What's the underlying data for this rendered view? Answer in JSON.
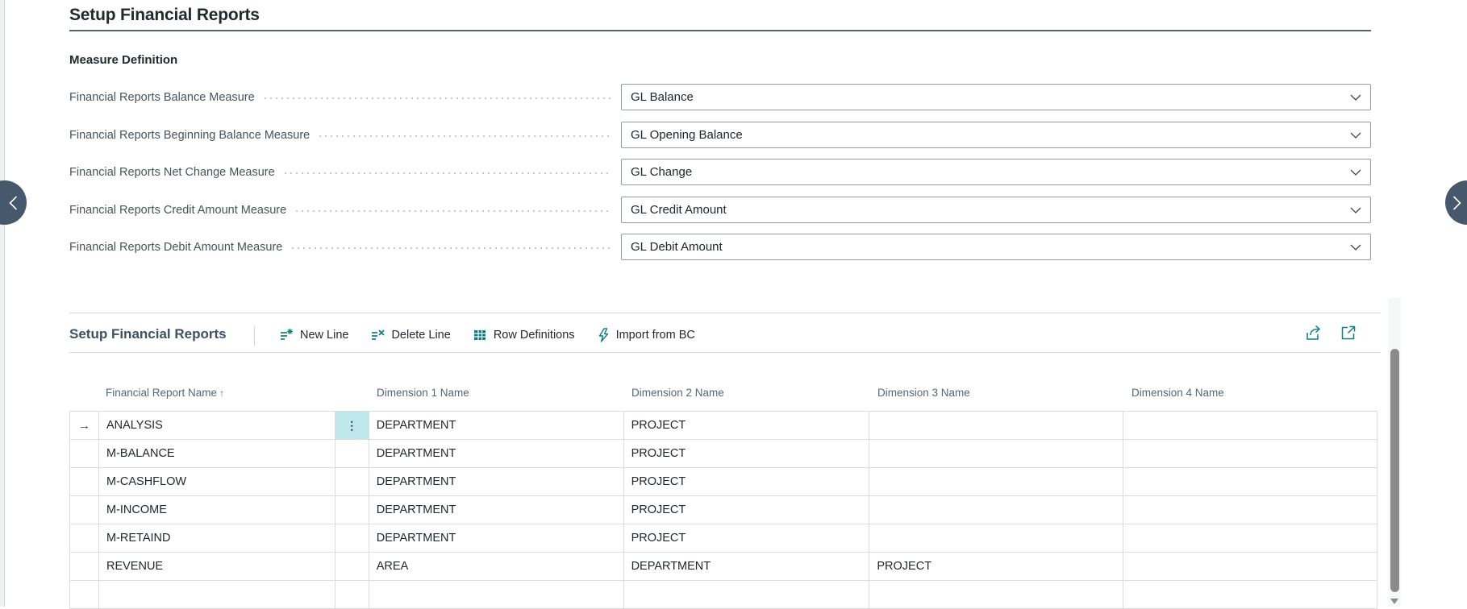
{
  "page": {
    "title": "Setup Financial Reports"
  },
  "measure_section": {
    "heading": "Measure Definition",
    "fields": [
      {
        "label": "Financial Reports Balance Measure",
        "value": "GL Balance"
      },
      {
        "label": "Financial Reports Beginning Balance Measure",
        "value": "GL Opening Balance"
      },
      {
        "label": "Financial Reports Net Change Measure",
        "value": "GL Change"
      },
      {
        "label": "Financial Reports Credit Amount Measure",
        "value": "GL Credit Amount"
      },
      {
        "label": "Financial Reports Debit Amount Measure",
        "value": "GL Debit Amount"
      }
    ]
  },
  "list_section": {
    "heading": "Setup Financial Reports",
    "toolbar": [
      {
        "label": "New Line",
        "icon": "new-line-icon"
      },
      {
        "label": "Delete Line",
        "icon": "delete-line-icon"
      },
      {
        "label": "Row Definitions",
        "icon": "row-definitions-icon"
      },
      {
        "label": "Import from BC",
        "icon": "import-from-bc-icon"
      }
    ],
    "actions": [
      {
        "icon": "share-icon"
      },
      {
        "icon": "expand-icon"
      }
    ],
    "table": {
      "columns": [
        "Financial Report Name",
        "Dimension 1 Name",
        "Dimension 2 Name",
        "Dimension 3 Name",
        "Dimension 4 Name"
      ],
      "sort_column": "Financial Report Name",
      "sort_indicator": "↑",
      "selected_row_marker": "→",
      "row_options_glyph": "⋮",
      "rows": [
        {
          "name": "ANALYSIS",
          "dim1": "DEPARTMENT",
          "dim2": "PROJECT",
          "dim3": "",
          "dim4": ""
        },
        {
          "name": "M-BALANCE",
          "dim1": "DEPARTMENT",
          "dim2": "PROJECT",
          "dim3": "",
          "dim4": ""
        },
        {
          "name": "M-CASHFLOW",
          "dim1": "DEPARTMENT",
          "dim2": "PROJECT",
          "dim3": "",
          "dim4": ""
        },
        {
          "name": "M-INCOME",
          "dim1": "DEPARTMENT",
          "dim2": "PROJECT",
          "dim3": "",
          "dim4": ""
        },
        {
          "name": "M-RETAIND",
          "dim1": "DEPARTMENT",
          "dim2": "PROJECT",
          "dim3": "",
          "dim4": ""
        },
        {
          "name": "REVENUE",
          "dim1": "AREA",
          "dim2": "DEPARTMENT",
          "dim3": "PROJECT",
          "dim4": ""
        },
        {
          "name": "",
          "dim1": "",
          "dim2": "",
          "dim3": "",
          "dim4": ""
        }
      ]
    }
  },
  "colors": {
    "accent_teal": "#0c7e87",
    "section_heading": "#3d5065",
    "selected_cell_bg": "#bfe8ec",
    "nav_circle": "#47586c",
    "scrollbar_thumb": "#8b8b8b"
  }
}
